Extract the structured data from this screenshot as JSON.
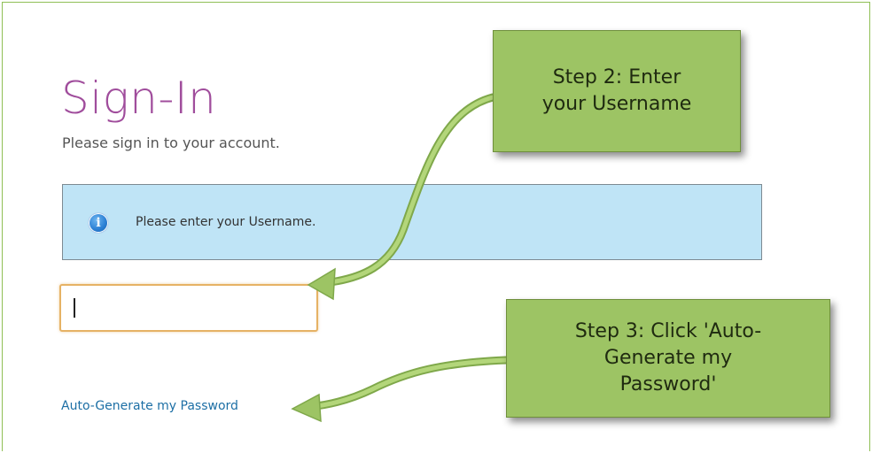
{
  "signin": {
    "title": "Sign-In",
    "subtitle": "Please sign in to your account.",
    "info_message": "Please enter your Username.",
    "info_icon": "info-icon",
    "username_value": "",
    "auto_generate_link": "Auto-Generate my Password"
  },
  "callouts": {
    "step2": "Step 2: Enter\nyour Username",
    "step3": "Step 3: Click 'Auto-\nGenerate my\nPassword'"
  },
  "colors": {
    "title": "#a04d9c",
    "info_bg": "#bfe4f6",
    "input_border_focus": "#e6b265",
    "link": "#1d6fa5",
    "callout_bg": "#9dc464",
    "arrow": "#9dc464"
  }
}
